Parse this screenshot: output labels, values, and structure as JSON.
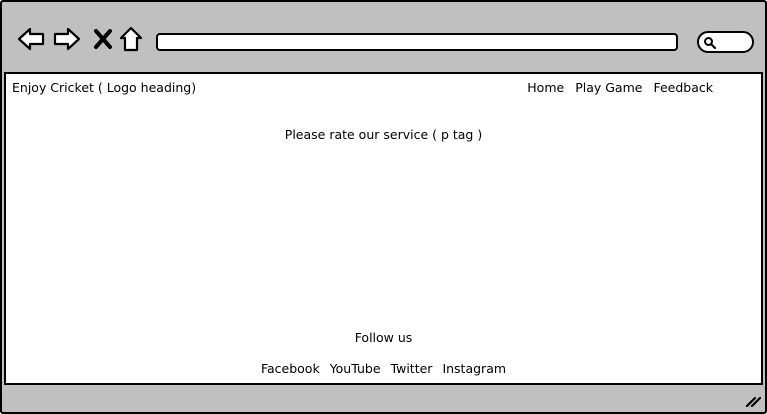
{
  "browser": {
    "icons": {
      "back": "back-arrow-icon",
      "forward": "forward-arrow-icon",
      "close": "close-x-icon",
      "home": "home-icon",
      "search": "search-icon",
      "resize": "resize-grip-icon"
    },
    "address_value": "",
    "search_value": ""
  },
  "header": {
    "logo": "Enjoy Cricket ( Logo heading)",
    "nav": [
      "Home",
      "Play Game",
      "Feedback"
    ]
  },
  "main": {
    "text": "Please rate our service ( p tag )"
  },
  "footer": {
    "follow": "Follow us",
    "links": [
      "Facebook",
      "YouTube",
      "Twitter",
      "Instagram"
    ]
  },
  "colors": {
    "chrome": "#c0c0c0",
    "outline": "#000000",
    "page": "#ffffff"
  }
}
